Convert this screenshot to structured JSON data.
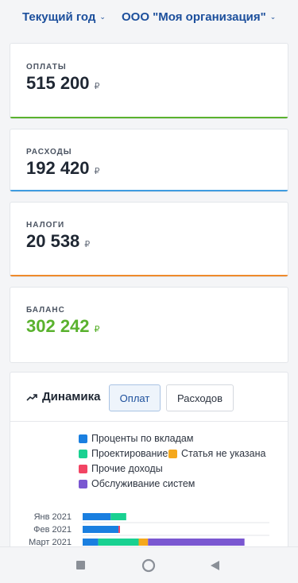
{
  "filters": {
    "period": "Текущий год",
    "organization": "ООО \"Моя организация\""
  },
  "summary": {
    "currency": "₽",
    "cards": [
      {
        "label": "ОПЛАТЫ",
        "value": "515 200",
        "accent": "#5ab22e"
      },
      {
        "label": "РАСХОДЫ",
        "value": "192 420",
        "accent": "#3f9ce0"
      },
      {
        "label": "НАЛОГИ",
        "value": "20 538",
        "accent": "#ef8a2c"
      },
      {
        "label": "БАЛАНС",
        "value": "302 242",
        "value_color": "#5ab22e"
      }
    ]
  },
  "dynamics": {
    "title": "Динамика",
    "tabs": [
      "Оплат",
      "Расходов"
    ],
    "active_tab": "Оплат"
  },
  "chart_data": {
    "type": "bar",
    "orientation": "horizontal",
    "stacked": true,
    "categories": [
      "Янв 2021",
      "Фев 2021",
      "Март 2021"
    ],
    "series": [
      {
        "name": "Проценты по вкладам",
        "color": "#1a7fe0",
        "values": [
          9000,
          11500,
          5000
        ]
      },
      {
        "name": "Проектирование",
        "color": "#19d191",
        "values": [
          5000,
          0,
          13000
        ]
      },
      {
        "name": "Статья не указана",
        "color": "#f5a81c",
        "values": [
          0,
          0,
          3000
        ]
      },
      {
        "name": "Прочие доходы",
        "color": "#f24463",
        "values": [
          0,
          500,
          0
        ]
      },
      {
        "name": "Обслуживание систем",
        "color": "#7a57d1",
        "values": [
          0,
          0,
          31000
        ]
      }
    ]
  },
  "navbar": {
    "icons": [
      "square-icon",
      "circle-icon",
      "back-triangle-icon"
    ]
  }
}
